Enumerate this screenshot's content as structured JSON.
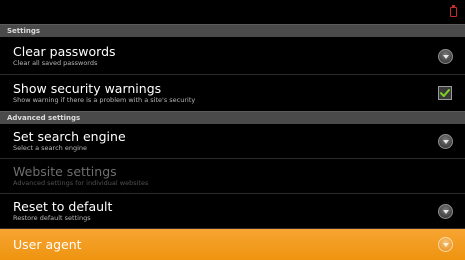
{
  "status_bar": {
    "battery_icon": "battery-low-icon",
    "battery_color": "#c62a2a"
  },
  "sections": [
    {
      "header": "Settings",
      "items": [
        {
          "title": "Clear passwords",
          "summary": "Clear all saved passwords",
          "widget": "dropdown-icon"
        },
        {
          "title": "Show security warnings",
          "summary": "Show warning if there is a problem with a site's security",
          "widget": "checkbox",
          "checked": true
        }
      ]
    },
    {
      "header": "Advanced settings",
      "items": [
        {
          "title": "Set search engine",
          "summary": "Select a search engine",
          "widget": "dropdown-icon"
        },
        {
          "title": "Website settings",
          "summary": "Advanced settings for individual websites",
          "widget": "none",
          "enabled": false
        },
        {
          "title": "Reset to default",
          "summary": "Restore default settings",
          "widget": "dropdown-icon"
        },
        {
          "title": "User agent",
          "summary": "",
          "widget": "dropdown-icon",
          "selected": true
        }
      ]
    }
  ],
  "colors": {
    "highlight": "#f39c12",
    "check": "#7ed321",
    "section_header_bg": "#4a4a4a"
  }
}
